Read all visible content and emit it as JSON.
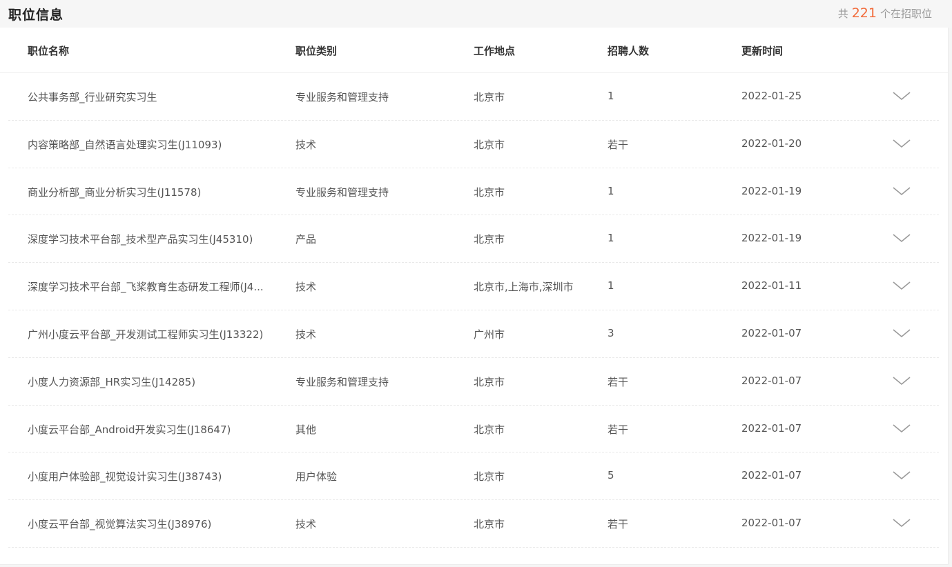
{
  "header": {
    "title": "职位信息",
    "count_prefix": "共",
    "count": "221",
    "count_suffix": "个在招职位"
  },
  "table": {
    "columns": {
      "name": "职位名称",
      "category": "职位类别",
      "location": "工作地点",
      "headcount": "招聘人数",
      "updated": "更新时间"
    },
    "rows": [
      {
        "name": "公共事务部_行业研究实习生",
        "category": "专业服务和管理支持",
        "location": "北京市",
        "headcount": "1",
        "updated": "2022-01-25"
      },
      {
        "name": "内容策略部_自然语言处理实习生(J11093)",
        "category": "技术",
        "location": "北京市",
        "headcount": "若干",
        "updated": "2022-01-20"
      },
      {
        "name": "商业分析部_商业分析实习生(J11578)",
        "category": "专业服务和管理支持",
        "location": "北京市",
        "headcount": "1",
        "updated": "2022-01-19"
      },
      {
        "name": "深度学习技术平台部_技术型产品实习生(J45310)",
        "category": "产品",
        "location": "北京市",
        "headcount": "1",
        "updated": "2022-01-19"
      },
      {
        "name": "深度学习技术平台部_飞桨教育生态研发工程师(J4...",
        "category": "技术",
        "location": "北京市,上海市,深圳市",
        "headcount": "1",
        "updated": "2022-01-11"
      },
      {
        "name": "广州小度云平台部_开发测试工程师实习生(J13322)",
        "category": "技术",
        "location": "广州市",
        "headcount": "3",
        "updated": "2022-01-07"
      },
      {
        "name": "小度人力资源部_HR实习生(J14285)",
        "category": "专业服务和管理支持",
        "location": "北京市",
        "headcount": "若干",
        "updated": "2022-01-07"
      },
      {
        "name": "小度云平台部_Android开发实习生(J18647)",
        "category": "其他",
        "location": "北京市",
        "headcount": "若干",
        "updated": "2022-01-07"
      },
      {
        "name": "小度用户体验部_视觉设计实习生(J38743)",
        "category": "用户体验",
        "location": "北京市",
        "headcount": "5",
        "updated": "2022-01-07"
      },
      {
        "name": "小度云平台部_视觉算法实习生(J38976)",
        "category": "技术",
        "location": "北京市",
        "headcount": "若干",
        "updated": "2022-01-07"
      }
    ]
  },
  "icons": {
    "expand": "chevron-down-icon"
  },
  "colors": {
    "accent": "#f26b3a"
  }
}
